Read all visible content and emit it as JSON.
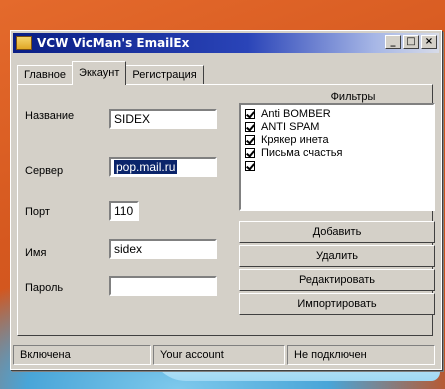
{
  "window": {
    "title": "VCW VicMan's EmailEx",
    "minimize_glyph": "_",
    "maximize_glyph": "□",
    "close_glyph": "×"
  },
  "tabs": [
    {
      "label": "Главное",
      "active": false
    },
    {
      "label": "Эккаунт",
      "active": true
    },
    {
      "label": "Регистрация",
      "active": false
    }
  ],
  "account": {
    "name_label": "Название",
    "name_value": "SIDEX",
    "server_label": "Сервер",
    "server_value": "pop.mail.ru",
    "port_label": "Порт",
    "port_value": "110",
    "user_label": "Имя",
    "user_value": "sidex",
    "password_label": "Пароль",
    "password_value": ""
  },
  "filters": {
    "title": "Фильтры",
    "items": [
      {
        "label": "Anti BOMBER",
        "checked": true
      },
      {
        "label": "ANTI SPAM",
        "checked": true
      },
      {
        "label": "Крякер инета",
        "checked": true
      },
      {
        "label": "Письма счастья",
        "checked": true
      },
      {
        "label": "",
        "checked": true
      }
    ]
  },
  "buttons": {
    "add": "Добавить",
    "delete": "Удалить",
    "edit": "Редактировать",
    "import": "Импортировать"
  },
  "status": {
    "state": "Включена",
    "account": "Your account",
    "connection": "Не подключен"
  },
  "colors": {
    "background_orange": "#d5581f",
    "titlebar_blue": "#0a1e84",
    "selection_blue": "#0a246a"
  }
}
